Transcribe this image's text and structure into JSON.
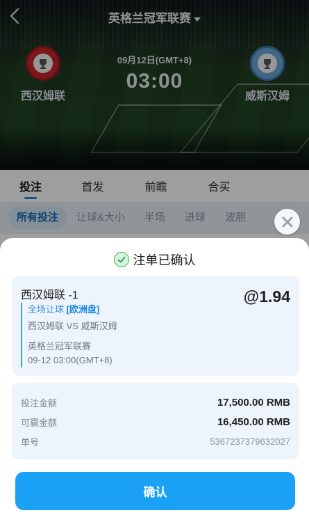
{
  "header": {
    "league_title": "英格兰冠军联赛",
    "back_icon": "chevron-left-icon",
    "dropdown_icon": "caret-down-icon"
  },
  "match": {
    "date": "09月12日(GMT+8)",
    "time": "03:00",
    "home_team": "西汉姆联",
    "away_team": "威斯汉姆"
  },
  "tabs": [
    {
      "label": "投注",
      "active": true
    },
    {
      "label": "首发",
      "active": false
    },
    {
      "label": "前瞻",
      "active": false
    },
    {
      "label": "合买",
      "active": false
    }
  ],
  "subtabs": [
    {
      "label": "所有投注",
      "active": true
    },
    {
      "label": "让球&大小",
      "active": false
    },
    {
      "label": "半场",
      "active": false
    },
    {
      "label": "进球",
      "active": false
    },
    {
      "label": "波胆",
      "active": false
    }
  ],
  "modal": {
    "title": "注单已确认",
    "title_icon": "check-circle-icon",
    "close_icon": "close-icon",
    "bet": {
      "selection": "西汉姆联 -1",
      "odds": "@1.94",
      "market": "全场让球",
      "market_tag": "[欧洲盘]",
      "matchup": "西汉姆联 VS 威斯汉姆",
      "league": "英格兰冠军联赛",
      "datetime": "09-12 03:00(GMT+8)"
    },
    "summary": {
      "stake_label": "投注金额",
      "stake_value": "17,500.00 RMB",
      "win_label": "可赢金额",
      "win_value": "16,450.00 RMB",
      "id_label": "单号",
      "id_value": "5367237379632027"
    },
    "confirm_label": "确认"
  },
  "colors": {
    "accent": "#1aa1f5",
    "tab_indicator": "#1a8ff0",
    "card_bg": "#eef4fb",
    "success": "#38b35a"
  }
}
